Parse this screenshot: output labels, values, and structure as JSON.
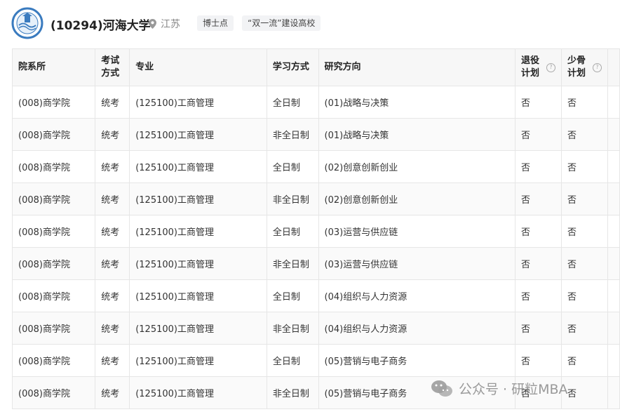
{
  "header": {
    "university_title": "(10294)河海大学",
    "location": "江苏",
    "tags": [
      "博士点",
      "“双一流”建设高校"
    ]
  },
  "table": {
    "headers": {
      "dept": "院系所",
      "exam": "考试方式",
      "major": "专业",
      "study_mode": "学习方式",
      "direction": "研究方向",
      "retired_plan": "退役计划",
      "minority_plan": "少骨计划"
    },
    "rows": [
      {
        "dept": "(008)商学院",
        "exam": "统考",
        "major": "(125100)工商管理",
        "study_mode": "全日制",
        "direction": "(01)战略与决策",
        "retired": "否",
        "minority": "否"
      },
      {
        "dept": "(008)商学院",
        "exam": "统考",
        "major": "(125100)工商管理",
        "study_mode": "非全日制",
        "direction": "(01)战略与决策",
        "retired": "否",
        "minority": "否"
      },
      {
        "dept": "(008)商学院",
        "exam": "统考",
        "major": "(125100)工商管理",
        "study_mode": "全日制",
        "direction": "(02)创意创新创业",
        "retired": "否",
        "minority": "否"
      },
      {
        "dept": "(008)商学院",
        "exam": "统考",
        "major": "(125100)工商管理",
        "study_mode": "非全日制",
        "direction": "(02)创意创新创业",
        "retired": "否",
        "minority": "否"
      },
      {
        "dept": "(008)商学院",
        "exam": "统考",
        "major": "(125100)工商管理",
        "study_mode": "全日制",
        "direction": "(03)运营与供应链",
        "retired": "否",
        "minority": "否"
      },
      {
        "dept": "(008)商学院",
        "exam": "统考",
        "major": "(125100)工商管理",
        "study_mode": "非全日制",
        "direction": "(03)运营与供应链",
        "retired": "否",
        "minority": "否"
      },
      {
        "dept": "(008)商学院",
        "exam": "统考",
        "major": "(125100)工商管理",
        "study_mode": "全日制",
        "direction": "(04)组织与人力资源",
        "retired": "否",
        "minority": "否"
      },
      {
        "dept": "(008)商学院",
        "exam": "统考",
        "major": "(125100)工商管理",
        "study_mode": "非全日制",
        "direction": "(04)组织与人力资源",
        "retired": "否",
        "minority": "否"
      },
      {
        "dept": "(008)商学院",
        "exam": "统考",
        "major": "(125100)工商管理",
        "study_mode": "全日制",
        "direction": "(05)营销与电子商务",
        "retired": "否",
        "minority": "否"
      },
      {
        "dept": "(008)商学院",
        "exam": "统考",
        "major": "(125100)工商管理",
        "study_mode": "非全日制",
        "direction": "(05)营销与电子商务",
        "retired": "否",
        "minority": "否"
      }
    ]
  },
  "watermark": "公众号 · 研粒MBA",
  "icons": {
    "logo": "university-seal-icon",
    "location": "location-pin-icon",
    "help": "question-circle-icon",
    "watermark": "wechat-icon"
  },
  "colors": {
    "header_bg": "#f7f7f7",
    "border": "#e6e6e6",
    "tag_bg": "#f2f3f5",
    "logo_blue": "#3a7bbf"
  }
}
